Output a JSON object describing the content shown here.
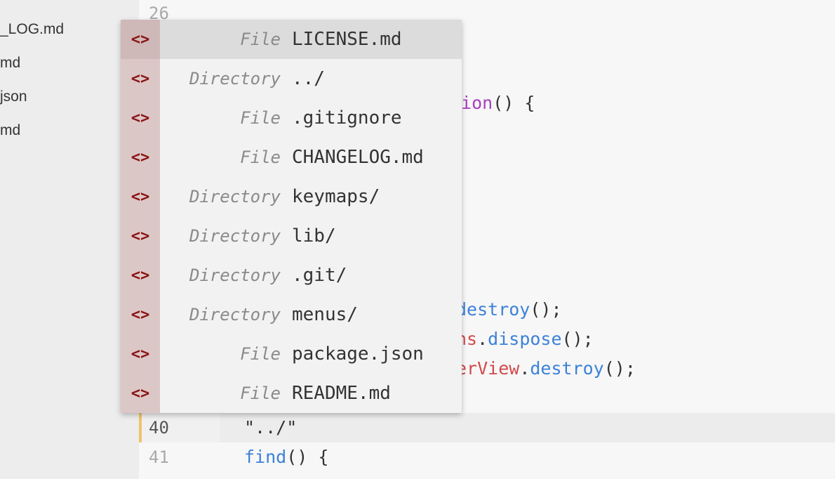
{
  "sidebar": {
    "items": [
      "_LOG.md",
      "md",
      "json",
      "md"
    ]
  },
  "editor": {
    "line_numbers": [
      "26",
      "40",
      "41"
    ],
    "lines": {
      "l26": "):",
      "l_function": "tion",
      "l_function_rest": "() {",
      "l_destroy_a": "destroy",
      "l_destroy_a_rest": "();",
      "l_dispose_var": "ns",
      "l_dispose_dot": ".",
      "l_dispose_fn": "dispose",
      "l_dispose_rest": "();",
      "l_view_var": "erView",
      "l_view_dot": ".",
      "l_view_fn": "destroy",
      "l_view_rest": "();",
      "l40": "\"../\"",
      "l41_fn": "find",
      "l41_rest": "() {"
    }
  },
  "autocomplete": {
    "icon": "code-brackets-icon",
    "icon_glyph": "<>",
    "items": [
      {
        "type": "File",
        "text": "LICENSE.md",
        "selected": true
      },
      {
        "type": "Directory",
        "text": "../"
      },
      {
        "type": "File",
        "text": ".gitignore"
      },
      {
        "type": "File",
        "text": "CHANGELOG.md"
      },
      {
        "type": "Directory",
        "text": "keymaps/"
      },
      {
        "type": "Directory",
        "text": "lib/"
      },
      {
        "type": "Directory",
        "text": ".git/"
      },
      {
        "type": "Directory",
        "text": "menus/"
      },
      {
        "type": "File",
        "text": "package.json"
      },
      {
        "type": "File",
        "text": "README.md"
      }
    ]
  },
  "colors": {
    "function": "#3b82d9",
    "keyword": "#a83fbf",
    "variable": "#d14a4a",
    "icon": "#8b1212",
    "gutter_marker": "#f0c36d"
  }
}
